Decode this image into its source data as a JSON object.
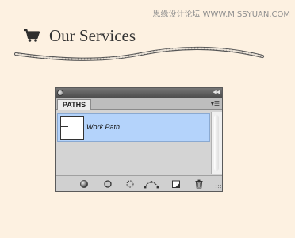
{
  "watermark": "思缘设计论坛  WWW.MISSYUAN.COM",
  "heading": {
    "icon": "shopping-cart-icon",
    "text": "Our Services"
  },
  "panel": {
    "tab_label": "PATHS",
    "paths": [
      {
        "name": "Work Path",
        "selected": true
      }
    ],
    "toolbar_icons": [
      "fill-path-icon",
      "stroke-path-icon",
      "load-as-selection-icon",
      "make-work-path-icon",
      "new-path-icon",
      "trash-icon"
    ]
  },
  "colors": {
    "background": "#fdf1e1",
    "selection": "#b4d3fb",
    "heading_text": "#333333"
  }
}
